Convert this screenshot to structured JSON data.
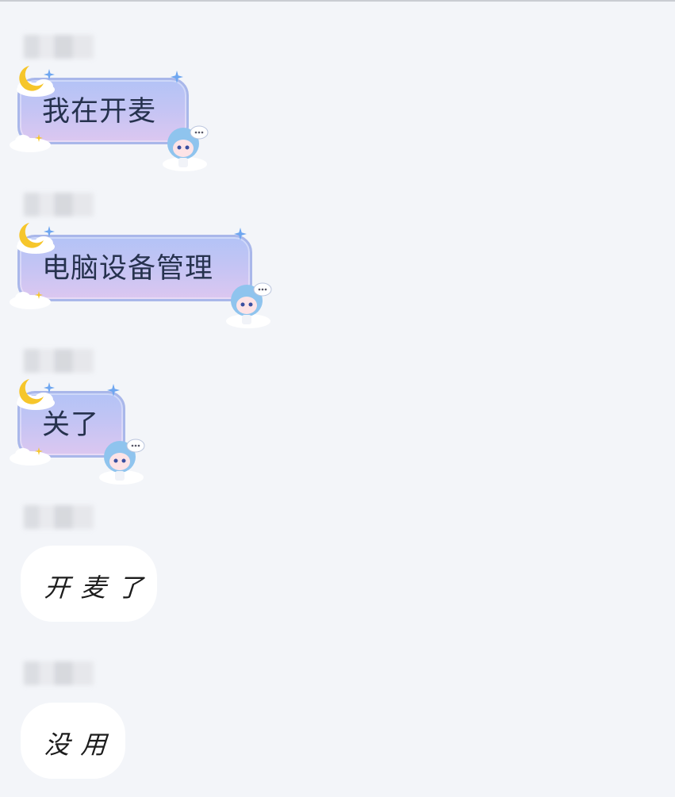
{
  "messages": [
    {
      "type": "themed",
      "text": "我在开麦"
    },
    {
      "type": "themed",
      "text": "电脑设备管理"
    },
    {
      "type": "themed",
      "text": "关了"
    },
    {
      "type": "plain",
      "text": "开麦了"
    },
    {
      "type": "plain",
      "text": "没用"
    }
  ],
  "colors": {
    "background": "#f3f5f9",
    "bubble_gradient_top": "#b3c3f6",
    "bubble_gradient_bottom": "#dcc7f0",
    "bubble_border": "#a9b7ea",
    "moon": "#f6c62b",
    "sparkle": "#6ea6f0",
    "plain_bubble": "#ffffff"
  },
  "icons": [
    "moon-icon",
    "sparkle-icon",
    "cloud-icon",
    "mascot-icon"
  ]
}
